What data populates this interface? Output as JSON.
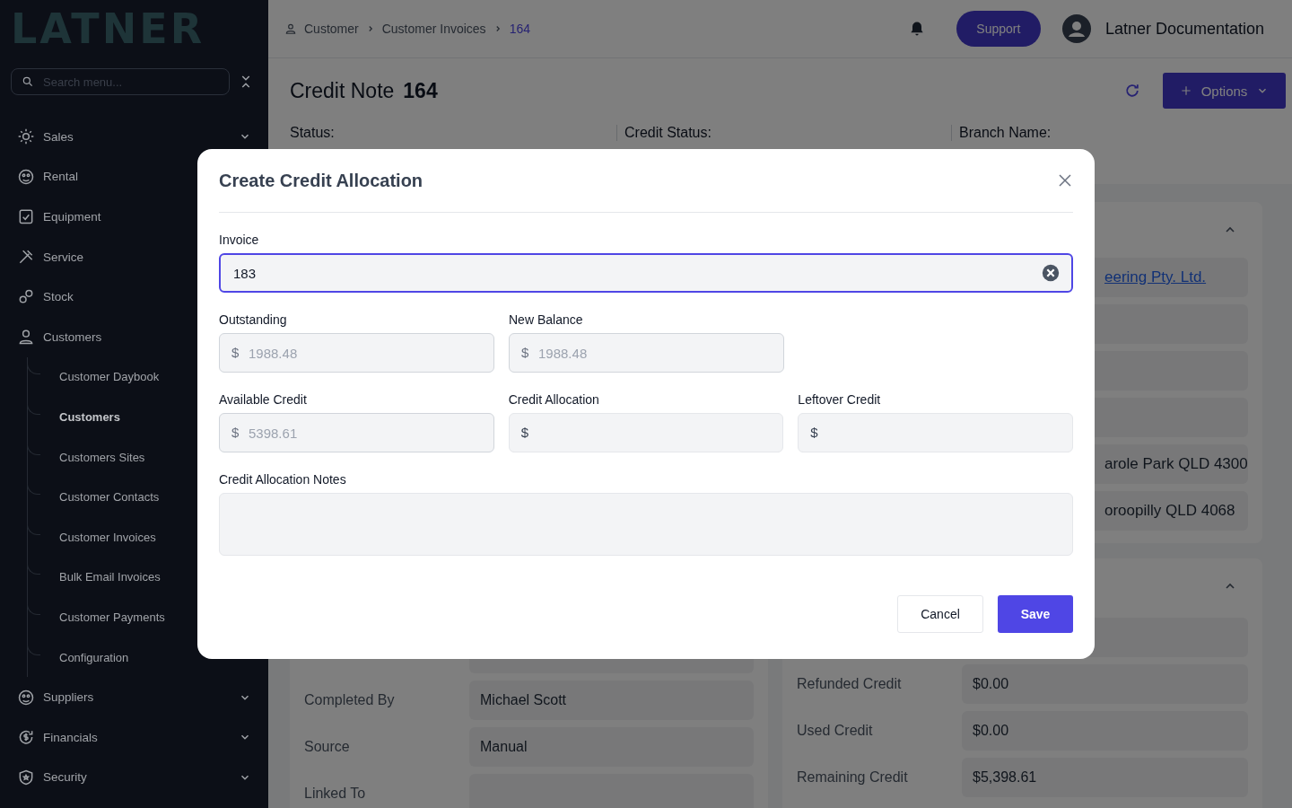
{
  "sidebar": {
    "logo": "LATNER",
    "search": {
      "placeholder": "Search menu..."
    },
    "items": [
      {
        "label": "Sales",
        "expanded": false
      },
      {
        "label": "Rental"
      },
      {
        "label": "Equipment"
      },
      {
        "label": "Service"
      },
      {
        "label": "Stock"
      },
      {
        "label": "Customers",
        "expanded": true,
        "children": [
          {
            "label": "Customer Daybook",
            "selected": false
          },
          {
            "label": "Customers",
            "selected": true
          },
          {
            "label": "Customers Sites",
            "selected": false
          },
          {
            "label": "Customer Contacts",
            "selected": false
          },
          {
            "label": "Customer Invoices",
            "selected": false
          },
          {
            "label": "Bulk Email Invoices",
            "selected": false
          },
          {
            "label": "Customer Payments",
            "selected": false
          },
          {
            "label": "Configuration",
            "selected": false
          }
        ]
      },
      {
        "label": "Suppliers",
        "expanded": false
      },
      {
        "label": "Financials",
        "expanded": false
      },
      {
        "label": "Security",
        "expanded": false
      }
    ]
  },
  "header": {
    "breadcrumb": [
      {
        "label": "Customer",
        "current": false
      },
      {
        "label": "Customer Invoices",
        "current": false
      },
      {
        "label": "164",
        "current": true
      }
    ],
    "support_button": "Support",
    "user": "Latner Documentation"
  },
  "page": {
    "title": "Credit Note",
    "number": "164",
    "options_button": "Options",
    "status_fields": [
      "Status:",
      "Credit Status:",
      "Branch Name:"
    ],
    "details_card": {
      "rows": [
        {
          "kind": "link",
          "value": "eering Pty. Ltd."
        },
        {
          "kind": "empty"
        },
        {
          "kind": "empty"
        },
        {
          "kind": "empty"
        },
        {
          "kind": "text",
          "value": "arole Park QLD 4300"
        },
        {
          "kind": "text",
          "value": "oroopilly QLD 4068"
        }
      ]
    },
    "info_card": {
      "rows": [
        {
          "kind": "empty"
        },
        {
          "kind": "text",
          "label": "Completed By",
          "value": "Michael Scott"
        },
        {
          "kind": "text",
          "label": "Source",
          "value": "Manual"
        },
        {
          "kind": "empty",
          "label": "Linked To"
        }
      ]
    },
    "credit_card": {
      "rows": [
        {
          "kind": "empty"
        },
        {
          "kind": "text",
          "label": "Refunded Credit",
          "value": "$0.00"
        },
        {
          "kind": "text",
          "label": "Used Credit",
          "value": "$0.00"
        },
        {
          "kind": "text",
          "label": "Remaining Credit",
          "value": "$5,398.61"
        }
      ]
    }
  },
  "modal": {
    "title": "Create Credit Allocation",
    "invoice": {
      "label": "Invoice",
      "value": "183"
    },
    "field_rows": [
      [
        {
          "label": "Outstanding",
          "prefix": "$",
          "value": "1988.48",
          "disabled": true
        },
        {
          "label": "New Balance",
          "prefix": "$",
          "value": "1988.48",
          "disabled": true
        }
      ],
      [
        {
          "label": "Available Credit",
          "prefix": "$",
          "value": "5398.61",
          "disabled": true
        },
        {
          "label": "Credit Allocation",
          "prefix": "$",
          "disabled": false
        },
        {
          "label": "Leftover Credit",
          "prefix": "$",
          "disabled": false
        }
      ]
    ],
    "notes": {
      "label": "Credit Allocation Notes"
    },
    "buttons": [
      {
        "label": "Cancel",
        "kind": "secondary"
      },
      {
        "label": "Save",
        "kind": "primary"
      }
    ]
  }
}
